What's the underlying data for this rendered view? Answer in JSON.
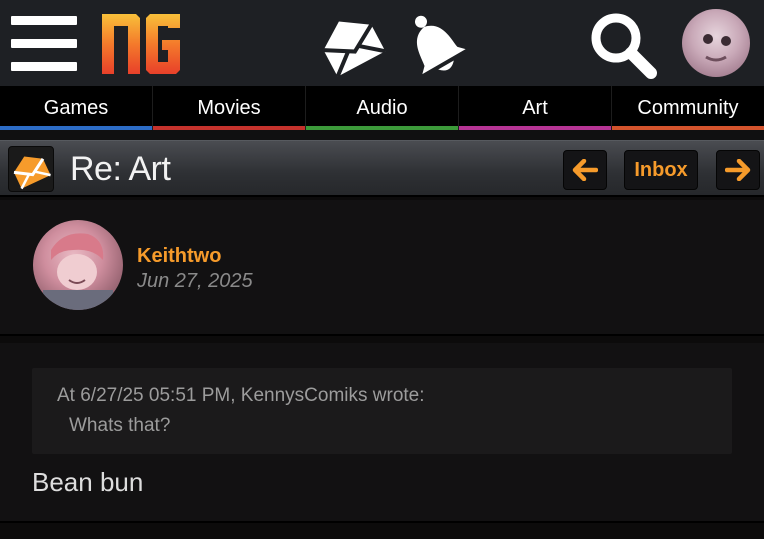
{
  "header": {
    "logo_text": "NG",
    "icons": [
      "menu-icon",
      "inbox-mail-icon",
      "notifications-bell-icon",
      "search-icon"
    ],
    "accent": "#f69b2b"
  },
  "nav": {
    "tabs": [
      {
        "label": "Games",
        "color": "#2c6cc6"
      },
      {
        "label": "Movies",
        "color": "#c5322c"
      },
      {
        "label": "Audio",
        "color": "#3c9a3a"
      },
      {
        "label": "Art",
        "color": "#b63494"
      },
      {
        "label": "Community",
        "color": "#d3532c"
      }
    ]
  },
  "thread": {
    "title": "Re: Art",
    "inbox_label": "Inbox",
    "prev_icon": "arrow-left-icon",
    "next_icon": "arrow-right-icon"
  },
  "post": {
    "author": "Keithtwo",
    "date": "Jun 27, 2025",
    "quote_header": "At 6/27/25 05:51 PM, KennysComiks wrote:",
    "quote_text": "Whats that?",
    "body": "Bean bun"
  }
}
